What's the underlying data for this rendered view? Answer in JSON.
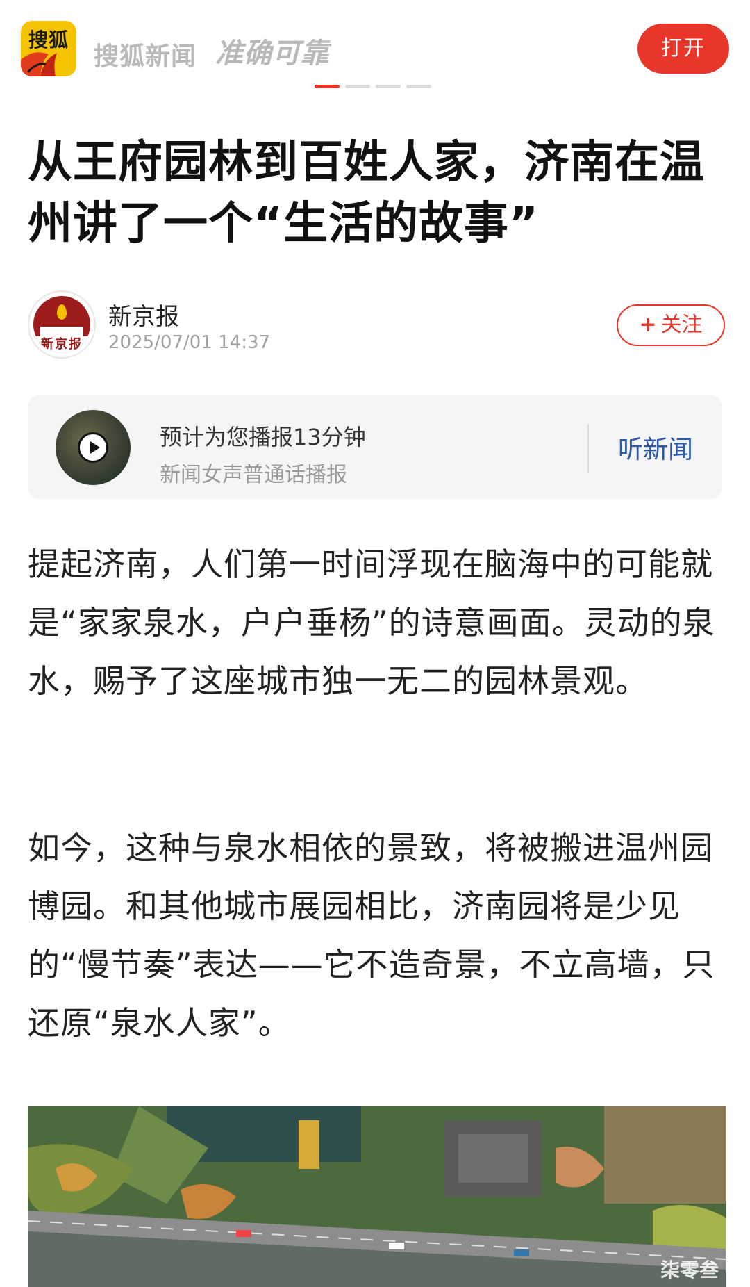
{
  "header": {
    "logo_text": "搜狐",
    "brand": "搜狐新闻",
    "slogan": "准确可靠",
    "open_label": "打开",
    "accent_color": "#e8372a",
    "carousel_pages": 4,
    "carousel_active": 1
  },
  "article": {
    "title": "从王府园林到百姓人家，济南在温州讲了一个“生活的故事”",
    "author": {
      "name": "新京报",
      "avatar_label": "新京报",
      "time": "2025/07/01 14:37",
      "follow_label": "关注",
      "follow_icon": "+"
    },
    "audio": {
      "title": "预计为您播报13分钟",
      "subtitle": "新闻女声普通话播报",
      "listen_label": "听新闻"
    },
    "paragraphs": [
      "提起济南，人们第一时间浮现在脑海中的可能就是“家家泉水，户户垂杨”的诗意画面。灵动的泉水，赐予了这座城市独一无二的园林景观。",
      "如今，这种与泉水相依的景致，将被搬进温州园博园。和其他城市展园相比，济南园将是少见的“慢节奏”表达——它不造奇景，不立高墙，只还原“泉水人家”。"
    ],
    "watermark": "柒零叁"
  }
}
